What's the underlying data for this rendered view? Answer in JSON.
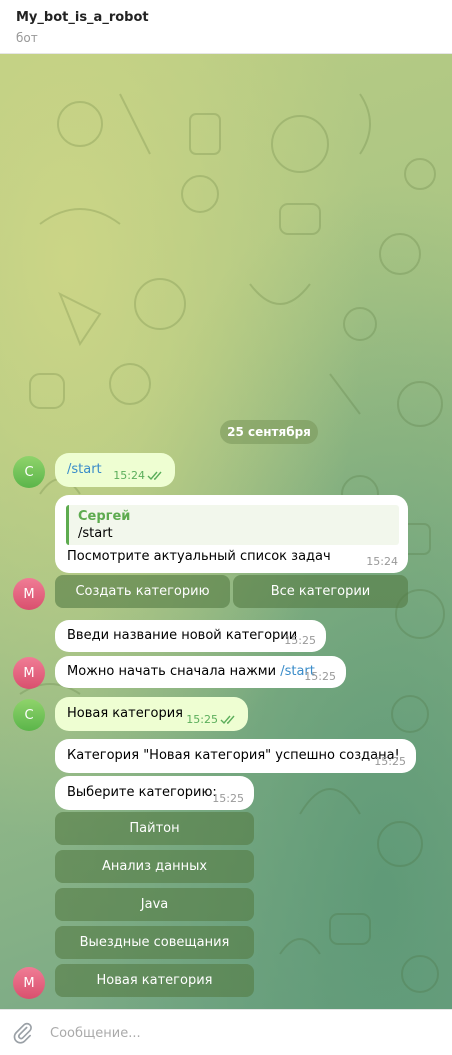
{
  "header": {
    "title": "My_bot_is_a_robot",
    "subtitle": "бот"
  },
  "date_separator": "25 сентября",
  "messages": {
    "m1": {
      "avatar": "С",
      "text": "/start",
      "time": "15:24",
      "status": "read"
    },
    "m2": {
      "avatar": "М",
      "reply_name": "Сергей",
      "reply_text": "/start",
      "text": "Посмотрите актуальный список задач",
      "time": "15:24",
      "buttons": [
        "Создать категорию",
        "Все категории"
      ]
    },
    "m3": {
      "text": "Введи название новой категории",
      "time": "15:25"
    },
    "m4": {
      "avatar": "М",
      "text_prefix": "Можно начать сначала нажми ",
      "link": "/start",
      "time": "15:25"
    },
    "m5": {
      "avatar": "С",
      "text": "Новая категория",
      "time": "15:25",
      "status": "read"
    },
    "m6": {
      "text": "Категория \"Новая категория\" успешно создана!",
      "time": "15:25"
    },
    "m7": {
      "avatar": "М",
      "text": "Выберите категорию:",
      "time": "15:25",
      "buttons": [
        "Пайтон",
        "Анализ данных",
        "Java",
        "Выездные совещания",
        "Новая категория"
      ]
    }
  },
  "composer": {
    "placeholder": "Сообщение..."
  },
  "colors": {
    "out_bubble": "#eefed2",
    "in_bubble": "#ffffff",
    "accent": "#5dab4f",
    "link": "#3a8cc9"
  }
}
